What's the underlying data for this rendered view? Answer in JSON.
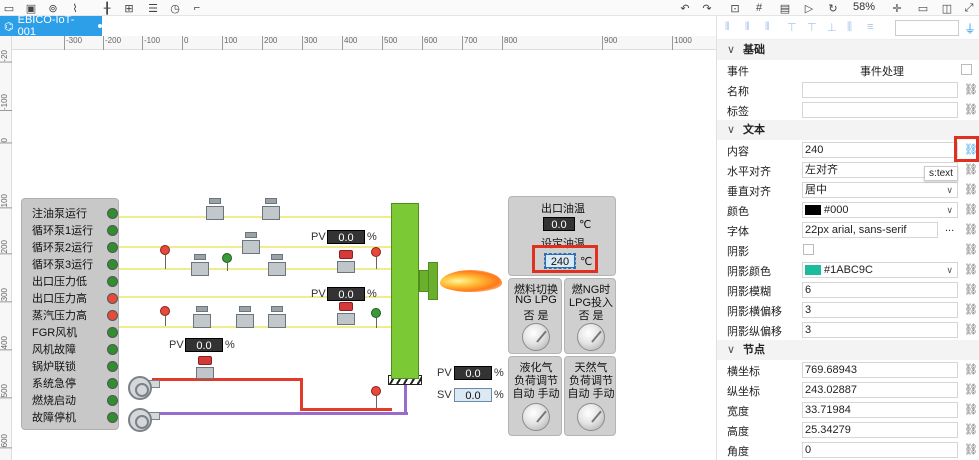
{
  "toolbar": {
    "icons": [
      "monitor-icon",
      "save-icon",
      "publish-icon",
      "link-icon",
      "split-icon",
      "group-icon",
      "document-icon",
      "clock-icon",
      "flow-icon",
      "undo-icon",
      "redo-icon",
      "grid-icon",
      "hash-icon",
      "save-file-icon",
      "play-icon",
      "refresh-icon",
      "crosshair-icon",
      "fit-icon",
      "fullscreen-icon"
    ],
    "zoom": "58%"
  },
  "tab": {
    "label": "EBICO-IoT-001"
  },
  "ruler": {
    "h_ticks": [
      "-300",
      "-200",
      "-100",
      "0",
      "100",
      "200",
      "300",
      "400",
      "500",
      "600",
      "700",
      "800",
      "900",
      "1000"
    ],
    "v_ticks": [
      "-20",
      "-100",
      "0",
      "100",
      "200",
      "300",
      "400",
      "500",
      "600"
    ]
  },
  "status_panel": {
    "rows": [
      {
        "label": "注油泵运行",
        "lamp": "green"
      },
      {
        "label": "循环泵1运行",
        "lamp": "green"
      },
      {
        "label": "循环泵2运行",
        "lamp": "green"
      },
      {
        "label": "循环泵3运行",
        "lamp": "green"
      },
      {
        "label": "出口压力低",
        "lamp": "green"
      },
      {
        "label": "出口压力高",
        "lamp": "red"
      },
      {
        "label": "蒸汽压力高",
        "lamp": "red"
      },
      {
        "label": "FGR风机",
        "lamp": "green"
      },
      {
        "label": "风机故障",
        "lamp": "green"
      },
      {
        "label": "锅炉联锁",
        "lamp": "green"
      },
      {
        "label": "系统急停",
        "lamp": "green"
      },
      {
        "label": "燃烧启动",
        "lamp": "green"
      },
      {
        "label": "故障停机",
        "lamp": "green"
      }
    ]
  },
  "meters": {
    "pv1": {
      "label": "PV",
      "value": "0.0",
      "unit": "%"
    },
    "pv2": {
      "label": "PV",
      "value": "0.0",
      "unit": "%"
    },
    "pv3": {
      "label": "PV",
      "value": "0.0",
      "unit": "%"
    },
    "pv4": {
      "label": "PV",
      "value": "0.0",
      "unit": "%"
    },
    "sv": {
      "label": "SV",
      "value": "0.0",
      "unit": "%"
    }
  },
  "oil_temp": {
    "title": "出口油温",
    "value": "0.0",
    "unit": "℃",
    "set_title": "设定油温",
    "set_value": "240",
    "set_unit": "℃"
  },
  "switch_panel_1": {
    "title": "燃料切换",
    "options": "NG  LPG",
    "choices": "否    是"
  },
  "switch_panel_2": {
    "title": "燃NG时",
    "subtitle": "LPG投入",
    "choices": "否    是"
  },
  "switch_panel_3": {
    "title": "液化气",
    "subtitle": "负荷调节",
    "choices": "自动  手动"
  },
  "switch_panel_4": {
    "title": "天然气",
    "subtitle": "负荷调节",
    "choices": "自动  手动"
  },
  "sidebar": {
    "sections": {
      "basic": "基础",
      "text": "文本",
      "node": "节点"
    },
    "event": {
      "label": "事件",
      "value": "事件处理"
    },
    "name": {
      "label": "名称",
      "value": ""
    },
    "tag": {
      "label": "标签",
      "value": ""
    },
    "content": {
      "label": "内容",
      "value": "240"
    },
    "halign": {
      "label": "水平对齐",
      "value": "左对齐"
    },
    "valign": {
      "label": "垂直对齐",
      "value": "居中"
    },
    "color": {
      "label": "颜色",
      "value": "#000"
    },
    "font": {
      "label": "字体",
      "value": "22px arial, sans-serif",
      "more": "..."
    },
    "shadow": {
      "label": "阴影"
    },
    "shadow_color": {
      "label": "阴影颜色",
      "value": "#1ABC9C"
    },
    "shadow_blur": {
      "label": "阴影模糊",
      "value": "6"
    },
    "shadow_x": {
      "label": "阴影横偏移",
      "value": "3"
    },
    "shadow_y": {
      "label": "阴影纵偏移",
      "value": "3"
    },
    "pos_x": {
      "label": "横坐标",
      "value": "769.68943"
    },
    "pos_y": {
      "label": "纵坐标",
      "value": "243.02887"
    },
    "width": {
      "label": "宽度",
      "value": "33.71984"
    },
    "height": {
      "label": "高度",
      "value": "25.34279"
    },
    "angle": {
      "label": "角度",
      "value": "0"
    },
    "tooltip": "s:text"
  },
  "colors": {
    "tab": "#2d9ee8",
    "boiler": "#7bc934",
    "highlight": "#e0301e",
    "shadow_swatch": "#1ABC9C",
    "color_swatch": "#000000"
  }
}
